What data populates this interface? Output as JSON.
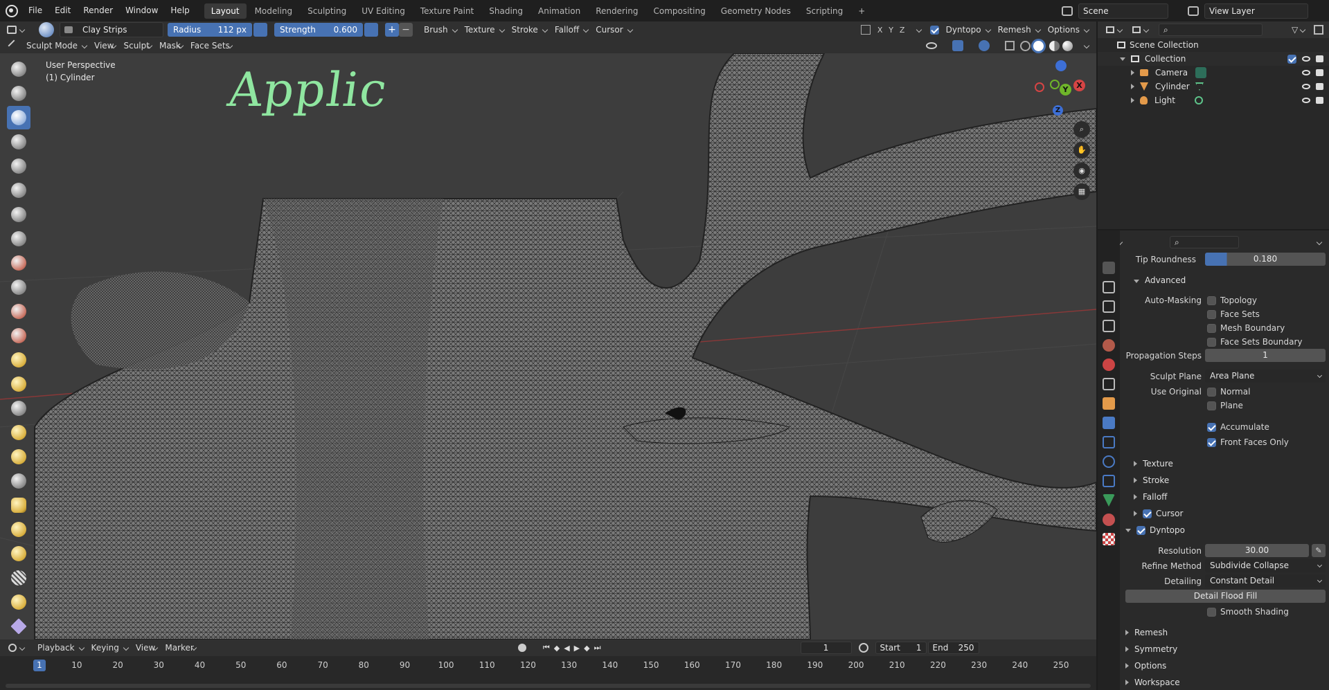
{
  "menu": {
    "items": [
      "File",
      "Edit",
      "Render",
      "Window",
      "Help"
    ]
  },
  "workspaces": {
    "tabs": [
      "Layout",
      "Modeling",
      "Sculpting",
      "UV Editing",
      "Texture Paint",
      "Shading",
      "Animation",
      "Rendering",
      "Compositing",
      "Geometry Nodes",
      "Scripting"
    ],
    "active": "Layout",
    "add": "+"
  },
  "scene": {
    "label": "Scene",
    "view_layer": "View Layer"
  },
  "tool_header": {
    "brush_name": "Clay Strips",
    "radius_label": "Radius",
    "radius_value": "112 px",
    "strength_label": "Strength",
    "strength_value": "0.600",
    "dropdowns": [
      "Brush",
      "Texture",
      "Stroke",
      "Falloff",
      "Cursor"
    ],
    "axes": [
      "X",
      "Y",
      "Z"
    ],
    "right": [
      "Dyntopo",
      "Remesh",
      "Options"
    ]
  },
  "mode_header": {
    "mode": "Sculpt Mode",
    "items": [
      "View",
      "Sculpt",
      "Mask",
      "Face Sets"
    ]
  },
  "viewport": {
    "perspective": "User Perspective",
    "object": "(1) Cylinder",
    "annotation": "Applic",
    "gizmo": {
      "x": "X",
      "y": "Y",
      "z": "Z"
    }
  },
  "outliner": {
    "root": "Scene Collection",
    "collection": "Collection",
    "objects": [
      "Camera",
      "Cylinder",
      "Light"
    ]
  },
  "properties": {
    "tip_roundness_label": "Tip Roundness",
    "tip_roundness_value": "0.180",
    "advanced": "Advanced",
    "auto_masking_label": "Auto-Masking",
    "auto_masking": [
      "Topology",
      "Face Sets",
      "Mesh Boundary",
      "Face Sets Boundary"
    ],
    "propagation_label": "Propagation Steps",
    "propagation_value": "1",
    "sculpt_plane_label": "Sculpt Plane",
    "sculpt_plane_value": "Area Plane",
    "use_original_label": "Use Original",
    "use_original": [
      "Normal",
      "Plane"
    ],
    "accumulate": "Accumulate",
    "front_faces": "Front Faces Only",
    "sections": [
      "Texture",
      "Stroke",
      "Falloff"
    ],
    "cursor": "Cursor",
    "dyntopo": "Dyntopo",
    "resolution_label": "Resolution",
    "resolution_value": "30.00",
    "refine_label": "Refine Method",
    "refine_value": "Subdivide Collapse",
    "detailing_label": "Detailing",
    "detailing_value": "Constant Detail",
    "flood_fill": "Detail Flood Fill",
    "smooth_shading": "Smooth Shading",
    "bottom_sections": [
      "Remesh",
      "Symmetry",
      "Options",
      "Workspace"
    ]
  },
  "timeline": {
    "menus": [
      "Playback",
      "Keying",
      "View",
      "Marker"
    ],
    "current_frame": "1",
    "start_label": "Start",
    "start_value": "1",
    "end_label": "End",
    "end_value": "250",
    "ticks": [
      "1",
      "10",
      "20",
      "30",
      "40",
      "50",
      "60",
      "70",
      "80",
      "90",
      "100",
      "110",
      "120",
      "130",
      "140",
      "150",
      "160",
      "170",
      "180",
      "190",
      "200",
      "210",
      "220",
      "230",
      "240",
      "250"
    ]
  },
  "colors": {
    "accent": "#4772b3",
    "annotation": "#8fe6a0"
  }
}
